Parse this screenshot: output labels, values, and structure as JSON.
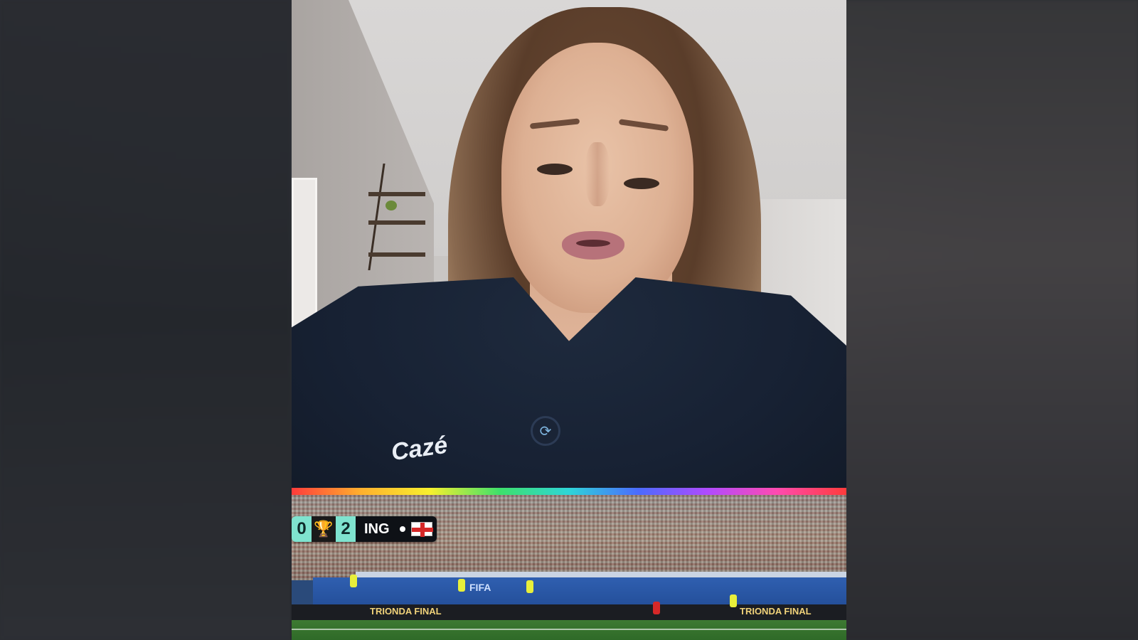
{
  "video": {
    "shirt_text": "Cazé",
    "mic_icon": "mic-icon"
  },
  "stadium": {
    "fifa_board": "FIFA",
    "board_left": "TRIONDA FINAL",
    "board_right": "TRIONDA FINAL"
  },
  "scorebug": {
    "home_score": "0",
    "away_score": "2",
    "team_code": "ING",
    "flag": "england-flag-icon",
    "trophy": "trophy-icon"
  },
  "colors": {
    "score_bg": "#7fe3cf",
    "team_bg": "#0e1116"
  }
}
